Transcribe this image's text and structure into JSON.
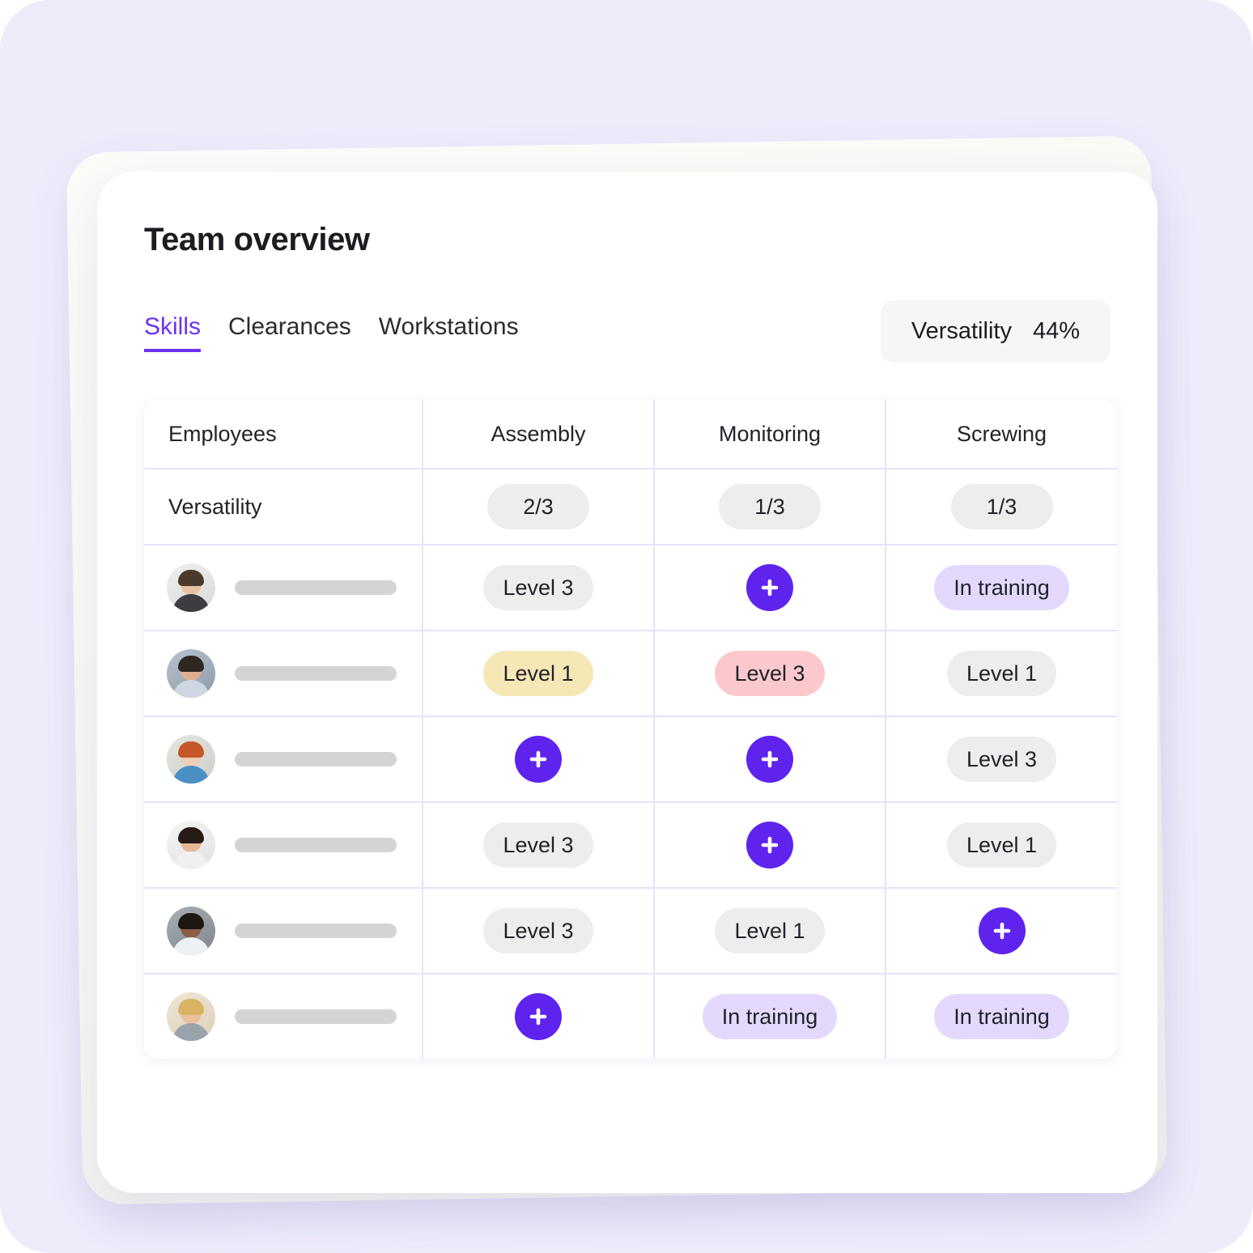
{
  "card": {
    "title": "Team overview"
  },
  "tabs": [
    {
      "label": "Skills",
      "active": true
    },
    {
      "label": "Clearances",
      "active": false
    },
    {
      "label": "Workstations",
      "active": false
    }
  ],
  "versatility_chip": {
    "label": "Versatility",
    "value": "44%"
  },
  "table": {
    "columns": [
      "Employees",
      "Assembly",
      "Monitoring",
      "Screwing"
    ],
    "versatility_row": {
      "label": "Versatility",
      "values": [
        "2/3",
        "1/3",
        "1/3"
      ]
    },
    "rows": [
      {
        "avatar": "avatar-employee-1",
        "name_redacted": true,
        "cells": [
          {
            "type": "pill",
            "style": "grey",
            "label": "Level 3"
          },
          {
            "type": "add",
            "style": "purple",
            "label": "+"
          },
          {
            "type": "pill",
            "style": "purple",
            "label": "In training"
          }
        ]
      },
      {
        "avatar": "avatar-employee-2",
        "name_redacted": true,
        "cells": [
          {
            "type": "pill",
            "style": "yellow",
            "label": "Level 1"
          },
          {
            "type": "pill",
            "style": "red",
            "label": "Level 3"
          },
          {
            "type": "pill",
            "style": "grey",
            "label": "Level 1"
          }
        ]
      },
      {
        "avatar": "avatar-employee-3",
        "name_redacted": true,
        "cells": [
          {
            "type": "add",
            "style": "purple",
            "label": "+"
          },
          {
            "type": "add",
            "style": "purple",
            "label": "+"
          },
          {
            "type": "pill",
            "style": "grey",
            "label": "Level 3"
          }
        ]
      },
      {
        "avatar": "avatar-employee-4",
        "name_redacted": true,
        "cells": [
          {
            "type": "pill",
            "style": "grey",
            "label": "Level 3"
          },
          {
            "type": "add",
            "style": "purple",
            "label": "+"
          },
          {
            "type": "pill",
            "style": "grey",
            "label": "Level 1"
          }
        ]
      },
      {
        "avatar": "avatar-employee-5",
        "name_redacted": true,
        "cells": [
          {
            "type": "pill",
            "style": "grey",
            "label": "Level 3"
          },
          {
            "type": "pill",
            "style": "grey",
            "label": "Level 1"
          },
          {
            "type": "add",
            "style": "purple",
            "label": "+"
          }
        ]
      },
      {
        "avatar": "avatar-employee-6",
        "name_redacted": true,
        "cells": [
          {
            "type": "add",
            "style": "purple",
            "label": "+"
          },
          {
            "type": "pill",
            "style": "purple",
            "label": "In training"
          },
          {
            "type": "pill",
            "style": "purple",
            "label": "In training"
          }
        ]
      }
    ]
  },
  "colors": {
    "page_background": "#eeecfb",
    "card_background": "#ffffff",
    "accent_purple": "#6b32f5",
    "add_button_purple": "#5f23ee",
    "pill_grey": "#ededed",
    "pill_yellow": "#f6e7b6",
    "pill_red": "#fbc9cd",
    "pill_purple": "#e4d9fd",
    "grid_line": "#e6e2fb",
    "text_primary": "#22222a"
  }
}
